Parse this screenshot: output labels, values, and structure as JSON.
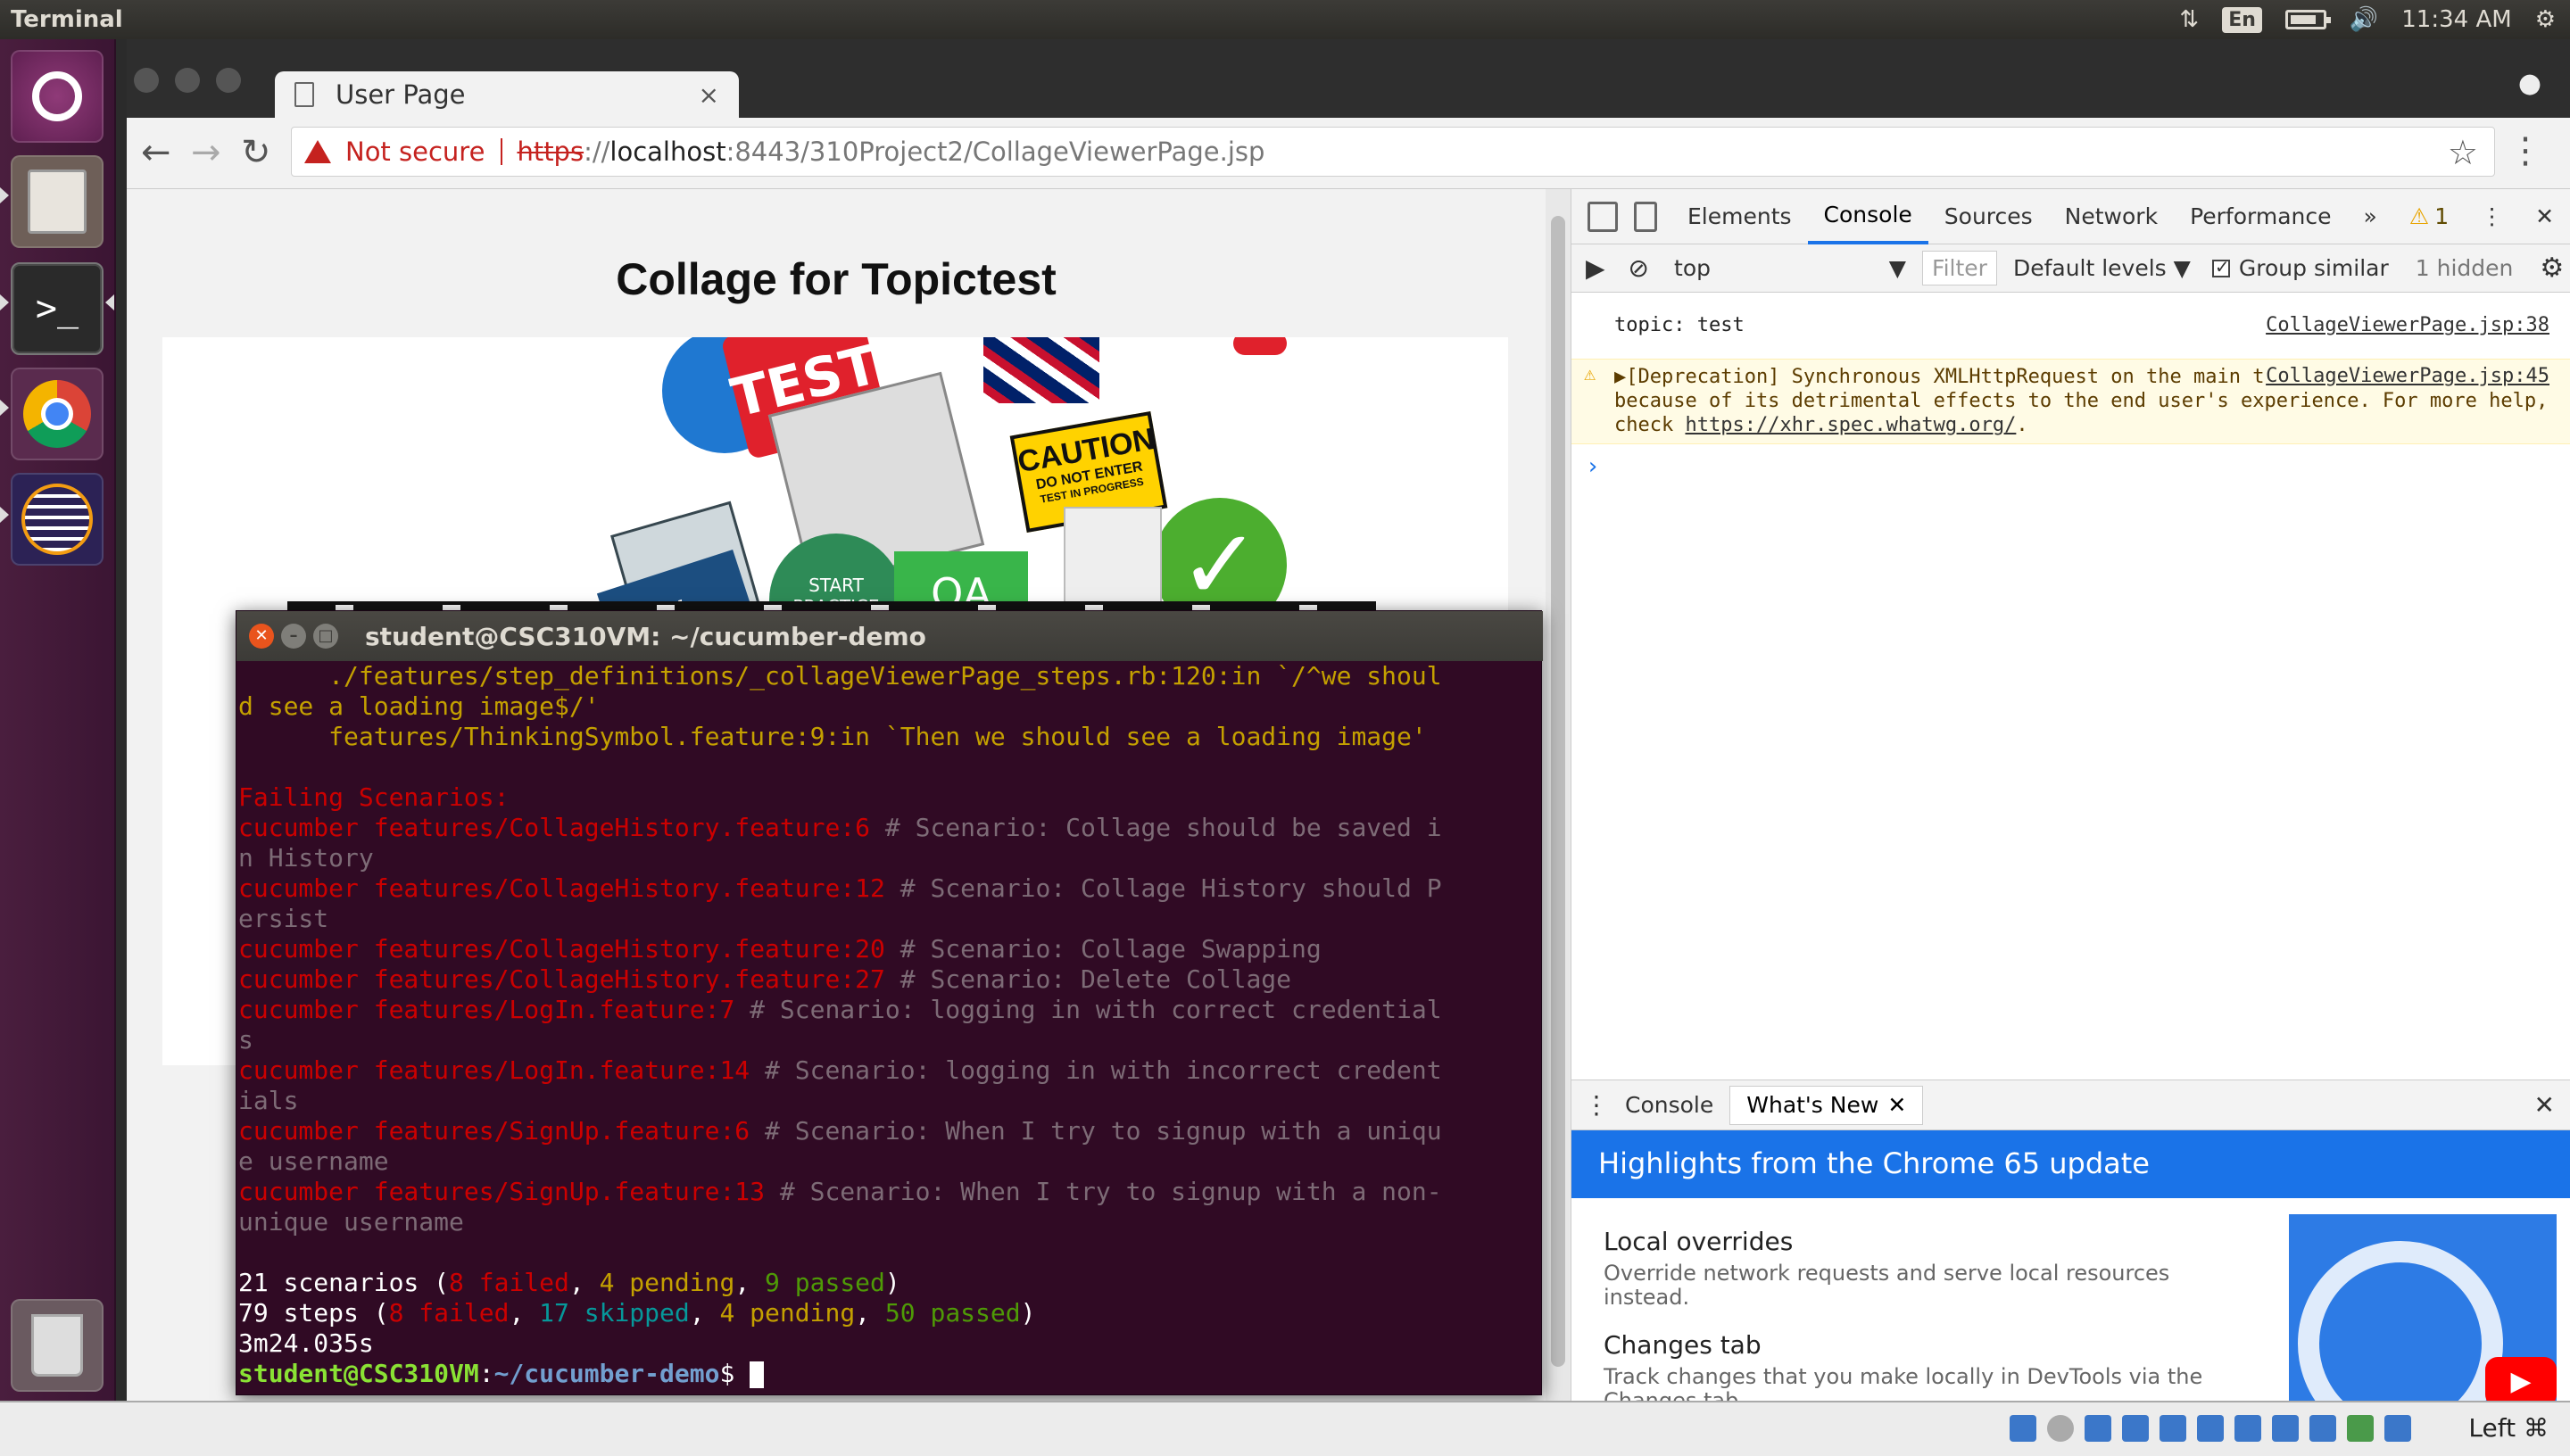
{
  "panel": {
    "app_title": "Terminal",
    "keyboard": "En",
    "clock": "11:34 AM"
  },
  "launcher": {
    "items": [
      "ubuntu-dash",
      "files",
      "terminal",
      "chrome",
      "eclipse",
      "trash"
    ]
  },
  "browser": {
    "tab_title": "User Page",
    "tab_close": "×",
    "omnibox": {
      "security_label": "Not secure",
      "scheme": "https",
      "after_scheme": "://",
      "host": "localhost",
      "rest": ":8443/310Project2/CollageViewerPage.jsp"
    },
    "page_title": "Collage for Topictest"
  },
  "devtools": {
    "tabs": [
      "Elements",
      "Console",
      "Sources",
      "Network",
      "Performance"
    ],
    "overflow": "»",
    "warning_count": "1",
    "context": "top",
    "filter_placeholder": "Filter",
    "levels": "Default levels ▼",
    "group_similar": "Group similar",
    "hidden": "1 hidden",
    "messages": [
      {
        "text": "topic: test",
        "source": "CollageViewerPage.jsp:38"
      }
    ],
    "warning": {
      "text_before_link": "▶[Deprecation] Synchronous XMLHttpRequest on the main thread is deprecated because of its detrimental effects to the end user's experience. For more help, check ",
      "link": "https://xhr.spec.whatwg.org/",
      "after_link": ".",
      "source": "CollageViewerPage.jsp:45"
    },
    "prompt": "›",
    "drawer": {
      "tabs": [
        "Console",
        "What's New"
      ],
      "banner": "Highlights from the Chrome 65 update",
      "items": [
        {
          "heading": "Local overrides",
          "text": "Override network requests and serve local resources instead."
        },
        {
          "heading": "Changes tab",
          "text": "Track changes that you make locally in DevTools via the Changes tab."
        }
      ]
    }
  },
  "collage_words": {
    "test": "TEST",
    "caution": "CAUTION",
    "caution_sub": "DO NOT ENTER",
    "caution_sub2": "TEST IN PROGRESS",
    "practice": "START PRACTICE TEST",
    "qa": "QA"
  },
  "terminal": {
    "title": "student@CSC310VM: ~/cucumber-demo",
    "lines": [
      "      ./features/step_definitions/_collageViewerPage_steps.rb:120:in `/^we shoul",
      "d see a loading image$/'",
      "      features/ThinkingSymbol.feature:9:in `Then we should see a loading image'",
      "",
      "Failing Scenarios:"
    ],
    "failing": [
      {
        "cmd": "cucumber features/CollageHistory.feature:6",
        "comment": " # Scenario: Collage should be saved i",
        "wrap": "n History"
      },
      {
        "cmd": "cucumber features/CollageHistory.feature:12",
        "comment": " # Scenario: Collage History should P",
        "wrap": "ersist"
      },
      {
        "cmd": "cucumber features/CollageHistory.feature:20",
        "comment": " # Scenario: Collage Swapping",
        "wrap": null
      },
      {
        "cmd": "cucumber features/CollageHistory.feature:27",
        "comment": " # Scenario: Delete Collage",
        "wrap": null
      },
      {
        "cmd": "cucumber features/LogIn.feature:7",
        "comment": " # Scenario: logging in with correct credential",
        "wrap": "s"
      },
      {
        "cmd": "cucumber features/LogIn.feature:14",
        "comment": " # Scenario: logging in with incorrect credent",
        "wrap": "ials"
      },
      {
        "cmd": "cucumber features/SignUp.feature:6",
        "comment": " # Scenario: When I try to signup with a uniqu",
        "wrap": "e username"
      },
      {
        "cmd": "cucumber features/SignUp.feature:13",
        "comment": " # Scenario: When I try to signup with a non-",
        "wrap": "unique username"
      }
    ],
    "summary": {
      "scenarios_total": "21 scenarios (",
      "scenarios_failed": "8 failed",
      "sep1": ", ",
      "scenarios_pending": "4 pending",
      "sep2": ", ",
      "scenarios_passed": "9 passed",
      "close": ")",
      "steps_total": "79 steps (",
      "steps_failed": "8 failed",
      "steps_skipped": "17 skipped",
      "steps_pending": "4 pending",
      "steps_passed": "50 passed",
      "duration": "3m24.035s"
    },
    "prompt_user": "student@CSC310VM",
    "prompt_colon": ":",
    "prompt_path": "~/cucumber-demo",
    "prompt_dollar": "$ "
  },
  "statusbar": {
    "host_key": "Left ⌘"
  },
  "colors": {
    "terminal_bg": "#300a24",
    "launcher_bg": "#4a1e3e",
    "accent_blue": "#1a73e8",
    "error_red": "#c5221f"
  }
}
